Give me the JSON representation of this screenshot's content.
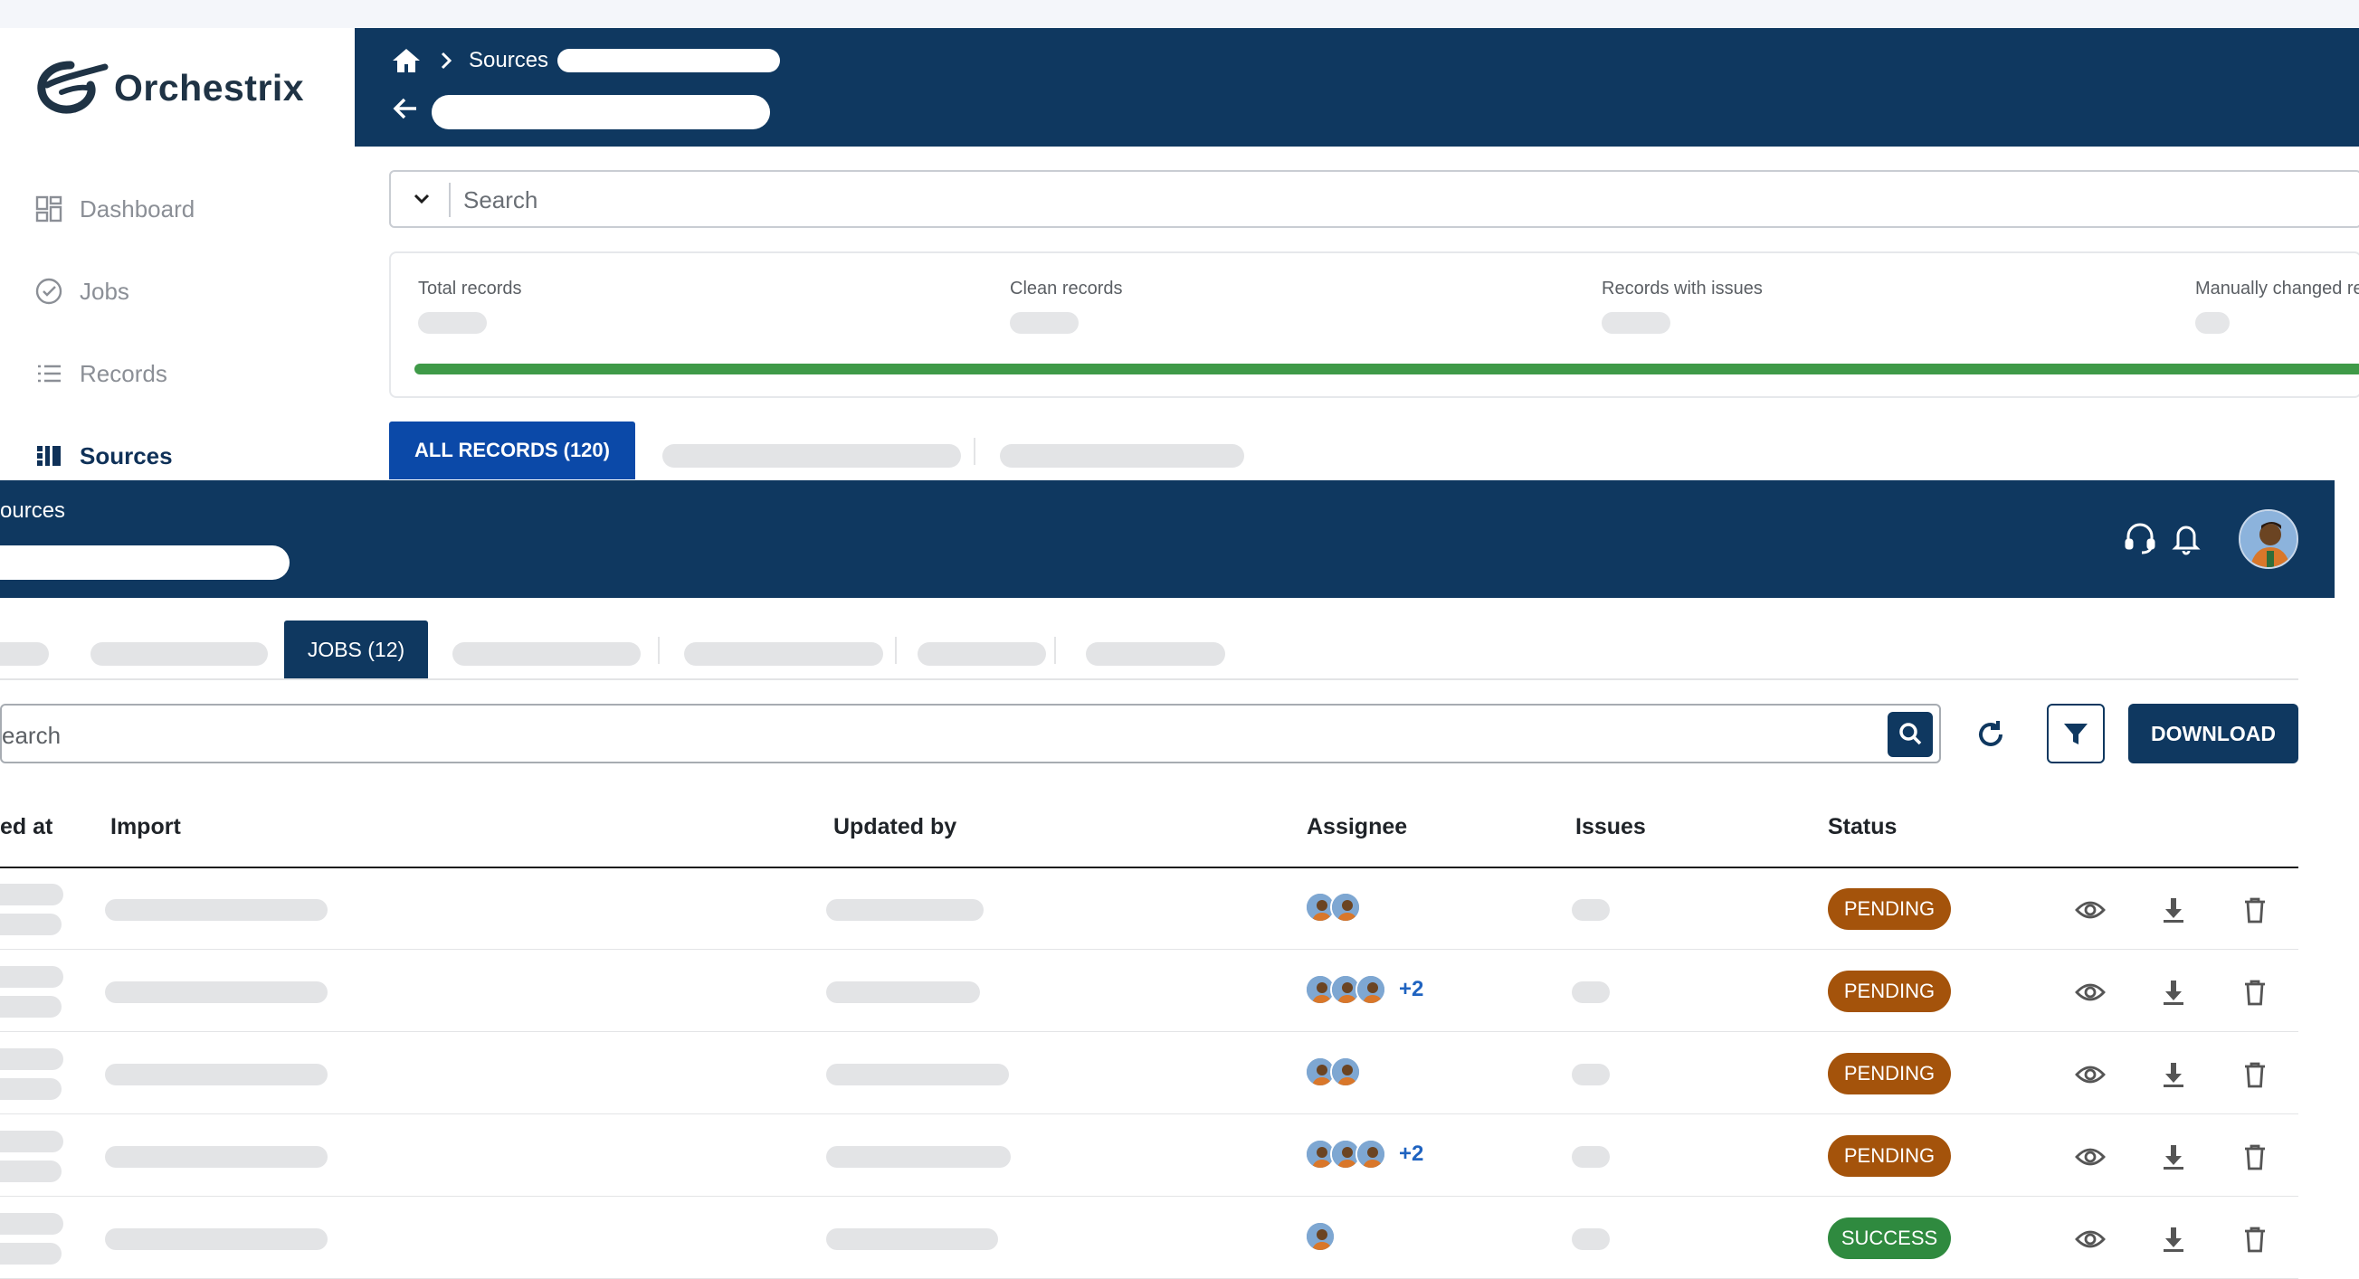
{
  "brand": {
    "name": "Orchestrix"
  },
  "sidebar": {
    "items": [
      {
        "label": "Dashboard",
        "icon": "dashboard-icon"
      },
      {
        "label": "Jobs",
        "icon": "check-circle-icon"
      },
      {
        "label": "Records",
        "icon": "list-icon"
      },
      {
        "label": "Sources",
        "icon": "sources-icon",
        "active": true
      }
    ]
  },
  "panel_top": {
    "breadcrumb": {
      "home_icon": "home-icon",
      "current": "Sources"
    },
    "search_placeholder": "Search",
    "stats": [
      {
        "label": "Total records"
      },
      {
        "label": "Clean records"
      },
      {
        "label": "Records with issues"
      },
      {
        "label": "Manually changed re"
      }
    ],
    "tab_all_records": "ALL RECORDS (120)"
  },
  "panel_bottom": {
    "breadcrumb": "ources",
    "tab_jobs": "JOBS (12)",
    "search_placeholder": "earch",
    "download_label": "DOWNLOAD",
    "columns": [
      "ed at",
      "Import",
      "Updated by",
      "Assignee",
      "Issues",
      "Status"
    ],
    "rows": [
      {
        "assignees": 2,
        "more": "",
        "status": "PENDING"
      },
      {
        "assignees": 3,
        "more": "+2",
        "status": "PENDING"
      },
      {
        "assignees": 2,
        "more": "",
        "status": "PENDING"
      },
      {
        "assignees": 3,
        "more": "+2",
        "status": "PENDING"
      },
      {
        "assignees": 1,
        "more": "",
        "status": "SUCCESS"
      }
    ]
  },
  "colors": {
    "header": "#0f3860",
    "accent_tab": "#0b49a8",
    "pending": "#a4530b",
    "success": "#2f8a3f",
    "progress": "#3f9a48"
  }
}
